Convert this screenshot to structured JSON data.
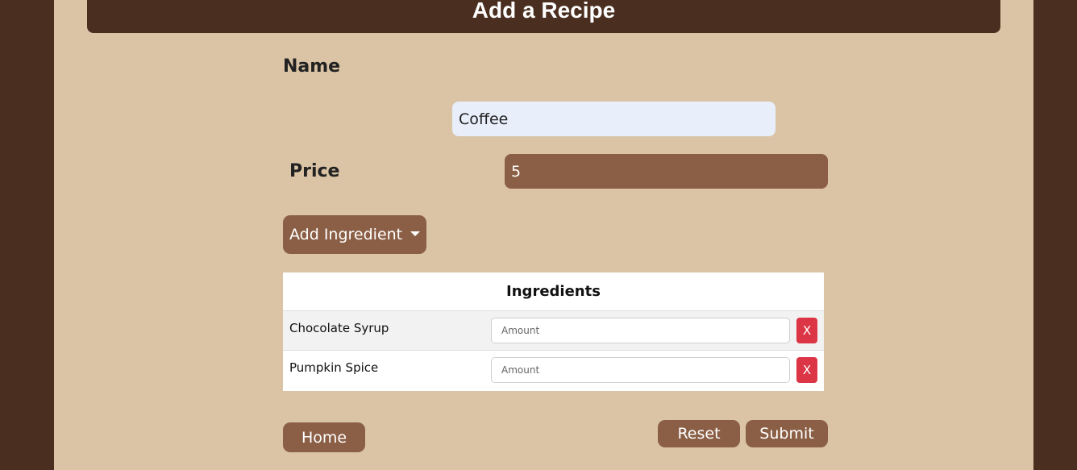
{
  "header": {
    "title": "Add a Recipe"
  },
  "form": {
    "name_label": "Name",
    "name_value": "Coffee",
    "price_label": "Price",
    "price_value": "5",
    "add_ingredient_label": "Add Ingredient"
  },
  "ingredients_table": {
    "header": "Ingredients",
    "amount_placeholder": "Amount",
    "remove_label": "X",
    "rows": [
      {
        "name": "Chocolate Syrup"
      },
      {
        "name": "Pumpkin Spice"
      }
    ]
  },
  "actions": {
    "home_label": "Home",
    "reset_label": "Reset",
    "submit_label": "Submit"
  },
  "colors": {
    "outer_bg": "#4a2f20",
    "page_bg": "#dac4a5",
    "button_bg": "#8b5f45",
    "remove_bg": "#dc3545",
    "name_input_bg": "#e8effb"
  }
}
